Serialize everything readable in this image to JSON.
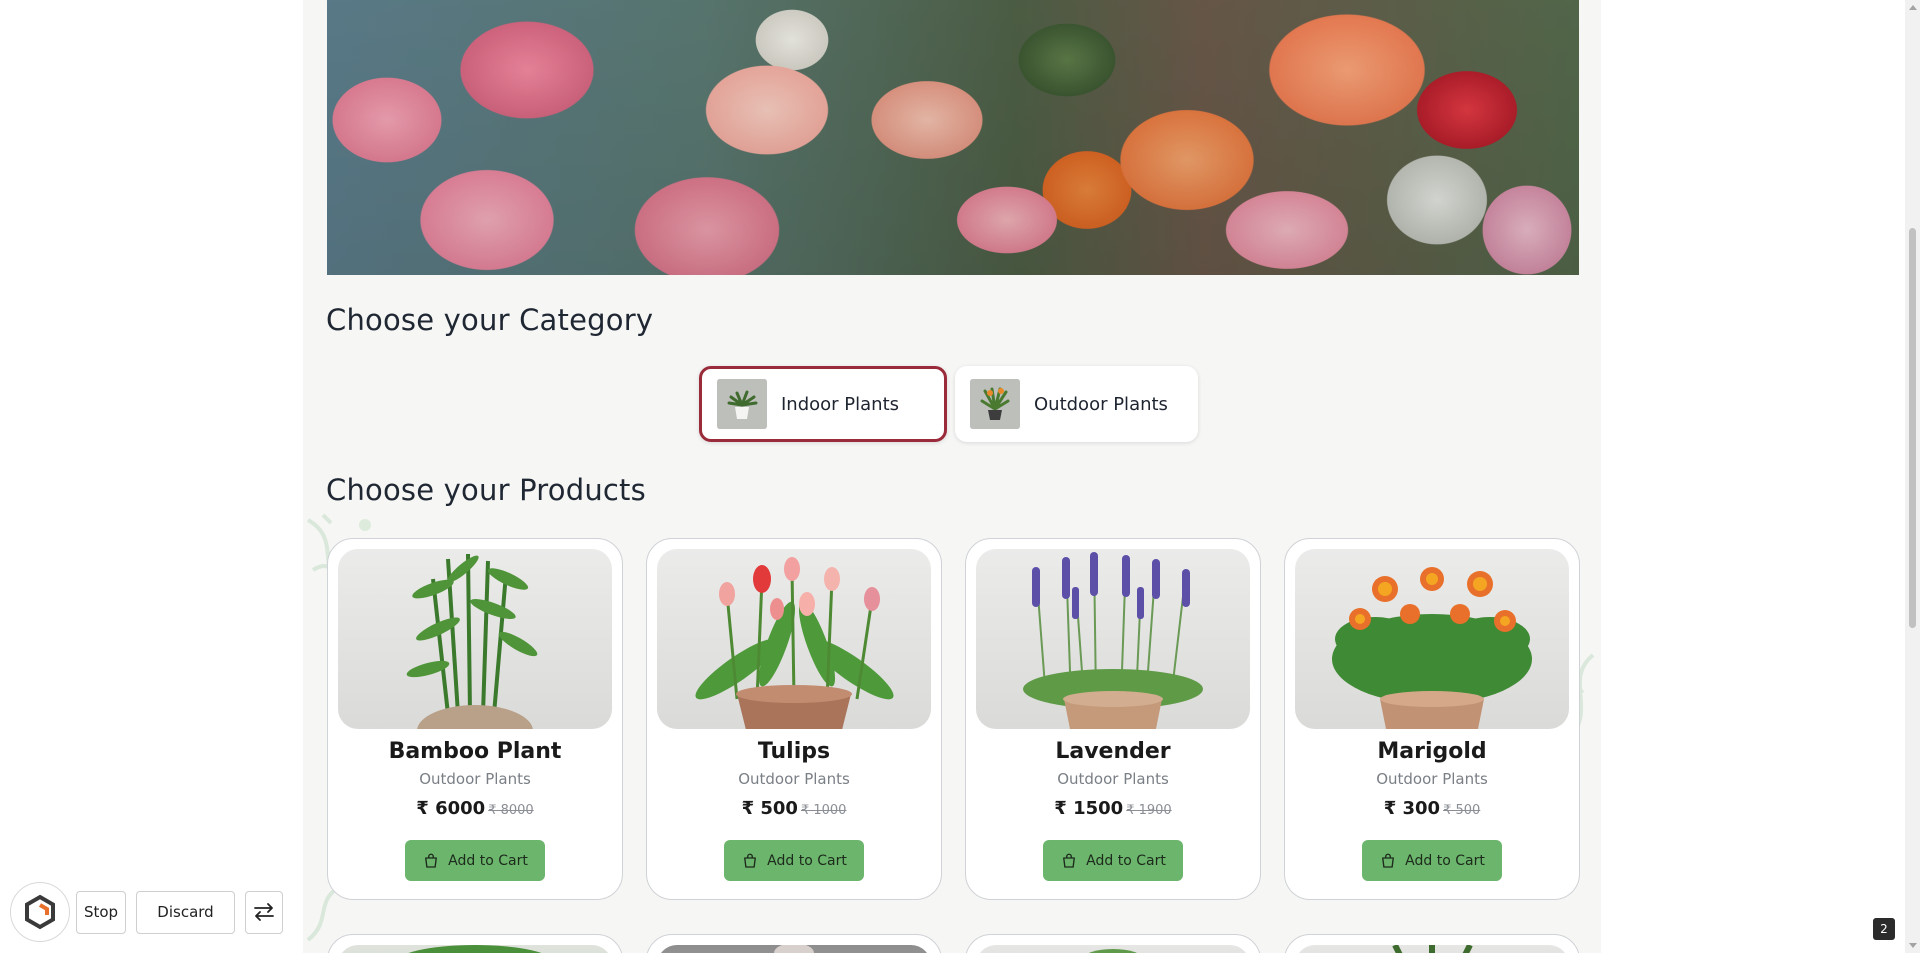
{
  "category_section": {
    "title": "Choose your Category",
    "items": [
      {
        "label": "Indoor Plants",
        "selected": true
      },
      {
        "label": "Outdoor Plants",
        "selected": false
      }
    ]
  },
  "products_section": {
    "title": "Choose your Products",
    "currency_symbol": "₹",
    "add_to_cart_label": "Add to Cart",
    "items": [
      {
        "name": "Bamboo Plant",
        "category": "Outdoor Plants",
        "price": "₹ 6000",
        "old_price": "₹ 8000"
      },
      {
        "name": "Tulips",
        "category": "Outdoor Plants",
        "price": "₹ 500",
        "old_price": "₹ 1000"
      },
      {
        "name": "Lavender",
        "category": "Outdoor Plants",
        "price": "₹ 1500",
        "old_price": "₹ 1900"
      },
      {
        "name": "Marigold",
        "category": "Outdoor Plants",
        "price": "₹ 300",
        "old_price": "₹ 500"
      }
    ]
  },
  "toolbar": {
    "stop_label": "Stop",
    "discard_label": "Discard"
  },
  "page_badge": "2",
  "colors": {
    "accent_green": "#6cb56c",
    "selected_border": "#9a2b3a",
    "page_bg": "#f6f6f5"
  }
}
